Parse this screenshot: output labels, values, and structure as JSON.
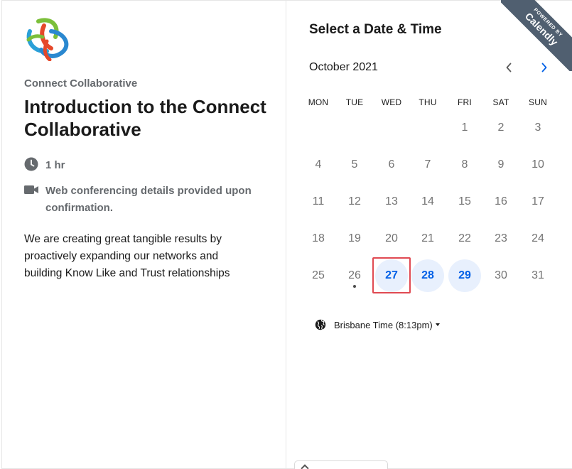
{
  "organization": {
    "name": "Connect Collaborative",
    "logo_icon": "connect-collaborative-logo"
  },
  "event": {
    "title": "Introduction to the Connect Collaborative",
    "duration": "1 hr",
    "duration_icon": "clock-icon",
    "conferencing": "Web conferencing details provided upon confirmation.",
    "conferencing_icon": "video-camera-icon",
    "description": "We are creating great tangible results by proactively expanding our networks and building Know Like and Trust relationships"
  },
  "scheduler": {
    "title": "Select a Date & Time",
    "month": "October 2021",
    "prev_icon": "chevron-left-icon",
    "next_icon": "chevron-right-icon",
    "weekdays": [
      "MON",
      "TUE",
      "WED",
      "THU",
      "FRI",
      "SAT",
      "SUN"
    ],
    "weeks": [
      [
        "",
        "",
        "",
        "",
        "1",
        "2",
        "3"
      ],
      [
        "4",
        "5",
        "6",
        "7",
        "8",
        "9",
        "10"
      ],
      [
        "11",
        "12",
        "13",
        "14",
        "15",
        "16",
        "17"
      ],
      [
        "18",
        "19",
        "20",
        "21",
        "22",
        "23",
        "24"
      ],
      [
        "25",
        "26",
        "27",
        "28",
        "29",
        "30",
        "31"
      ]
    ],
    "available_days": [
      "27",
      "28",
      "29"
    ],
    "today": "26",
    "highlighted_day": "27",
    "timezone": "Brisbane Time (8:13pm)",
    "timezone_icon": "globe-icon"
  },
  "badge": {
    "small": "POWERED BY",
    "brand": "Calendly"
  },
  "colors": {
    "accent": "#0060e6",
    "available_bg": "#e8f0fd",
    "highlight_box": "#e04a52",
    "ribbon": "#505f70"
  }
}
